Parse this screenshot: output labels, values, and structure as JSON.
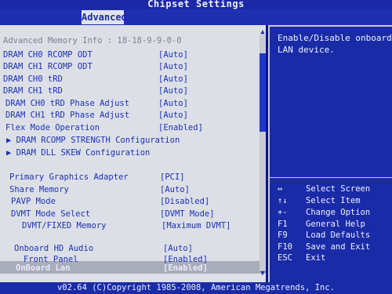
{
  "title": "Chipset Settings",
  "tabs": [
    {
      "label": "Advanced"
    }
  ],
  "memory_info": "Advanced Memory Info : 18-18-9-9-0-0",
  "settings": [
    {
      "label": "DRAM CH0 RCOMP ODT",
      "value": "[Auto]"
    },
    {
      "label": "DRAM CH1 RCOMP ODT",
      "value": "[Auto]"
    },
    {
      "label": "DRAM CH0 tRD",
      "value": "[Auto]"
    },
    {
      "label": "DRAM CH1 tRD",
      "value": "[Auto]"
    },
    {
      "label": "DRAM CH0 tRD Phase Adjust",
      "value": "[Auto]"
    },
    {
      "label": "DRAM CH1 tRD Phase Adjust",
      "value": "[Auto]"
    },
    {
      "label": "Flex Mode Operation",
      "value": "[Enabled]"
    }
  ],
  "submenus": [
    {
      "label": "DRAM RCOMP STRENGTH Configuration"
    },
    {
      "label": "DRAM DLL SKEW Configuration"
    }
  ],
  "graphics": [
    {
      "label": "Primary Graphics Adapter",
      "value": "[PCI]"
    },
    {
      "label": "Share Memory",
      "value": "[Auto]"
    },
    {
      "label": "PAVP Mode",
      "value": "[Disabled]"
    },
    {
      "label": "DVMT Mode Select",
      "value": "[DVMT Mode]"
    },
    {
      "label": "DVMT/FIXED Memory",
      "value": "[Maximum DVMT]"
    }
  ],
  "audio": [
    {
      "label": "Onboard HD Audio",
      "value": "[Auto]"
    },
    {
      "label": "Front Panel",
      "value": "[Enabled]"
    }
  ],
  "onboard_lan": {
    "label": "OnBoard Lan",
    "value": "[Enabled]"
  },
  "help": {
    "line1": "Enable/Disable onboard",
    "line2": "LAN device."
  },
  "keys": [
    {
      "key": "↔",
      "desc": "Select Screen"
    },
    {
      "key": "↑↓",
      "desc": "Select Item"
    },
    {
      "key": "+-",
      "desc": "Change Option"
    },
    {
      "key": "F1",
      "desc": "General Help"
    },
    {
      "key": "F9",
      "desc": "Load Defaults"
    },
    {
      "key": "F10",
      "desc": "Save and Exit"
    },
    {
      "key": "ESC",
      "desc": "Exit"
    }
  ],
  "footer": "v02.64 (C)Copyright 1985-2008, American Megatrends, Inc.",
  "colors": {
    "background": "#0a1490",
    "panel": "#dcdfe6",
    "text_blue": "#1a31b8",
    "help_bg": "#1a2ba8"
  }
}
